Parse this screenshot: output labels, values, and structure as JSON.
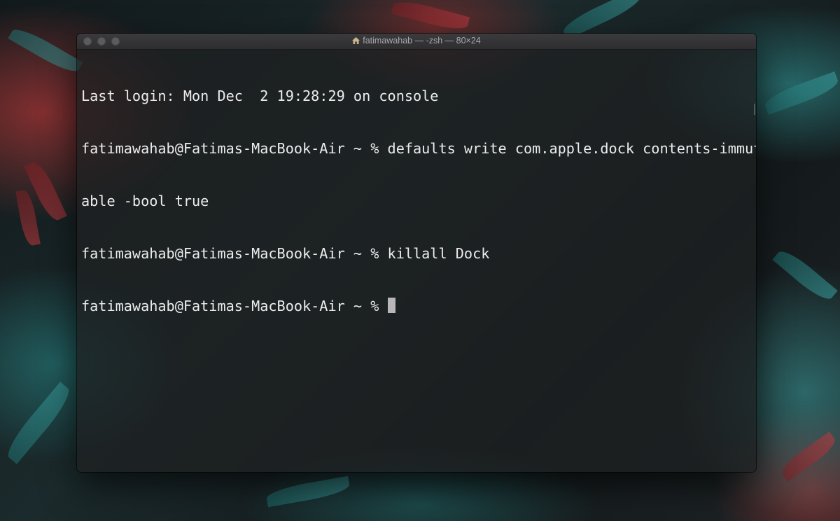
{
  "window": {
    "title": "fatimawahab — -zsh — 80×24",
    "title_icon": "home-folder-icon"
  },
  "terminal": {
    "lines": [
      "Last login: Mon Dec  2 19:28:29 on console",
      "fatimawahab@Fatimas-MacBook-Air ~ % defaults write com.apple.dock contents-immut",
      "able -bool true",
      "fatimawahab@Fatimas-MacBook-Air ~ % killall Dock",
      "fatimawahab@Fatimas-MacBook-Air ~ % "
    ]
  },
  "colors": {
    "terminal_text": "#ececec",
    "cursor": "#b7b7b7",
    "titlebar": "#333335"
  }
}
